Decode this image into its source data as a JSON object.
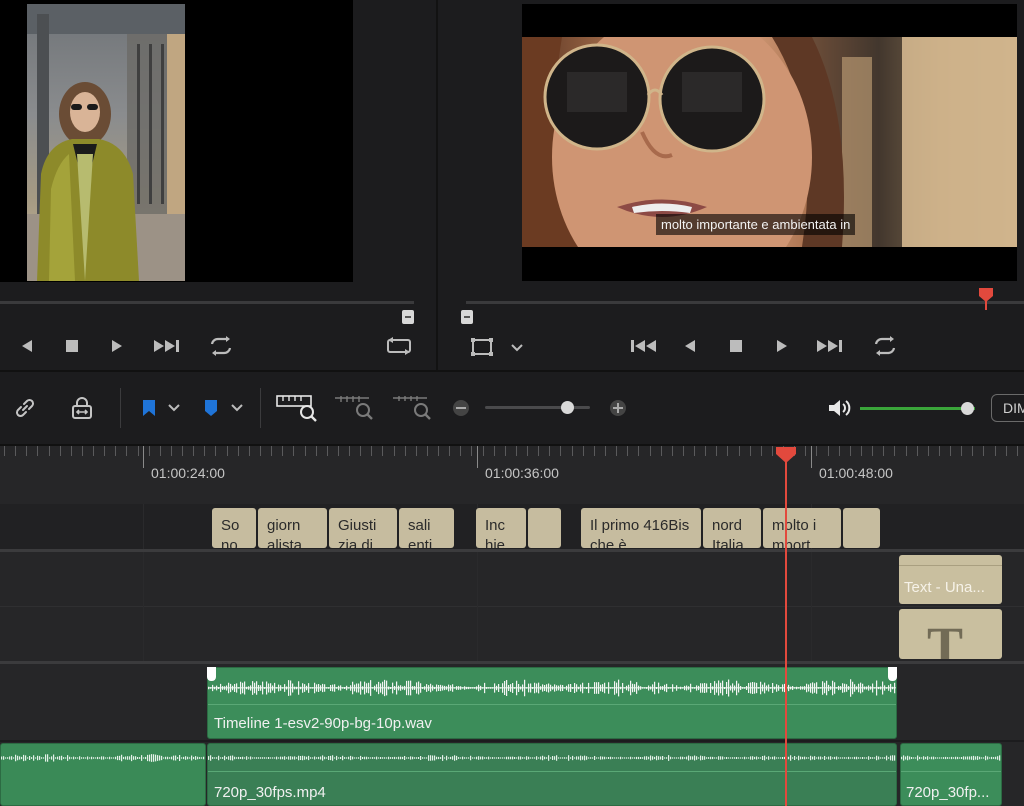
{
  "viewers": {
    "program_subtitle": "molto importante e ambientata in"
  },
  "timeline": {
    "timecodes": [
      "01:00:24:00",
      "01:00:36:00",
      "01:00:48:00"
    ],
    "subtitle_clips": [
      {
        "text": "So no"
      },
      {
        "text": "giorn alista"
      },
      {
        "text": "Giusti zia di"
      },
      {
        "text": "sali enti"
      },
      {
        "text": "Inc hie"
      },
      {
        "text": ""
      },
      {
        "text": "Il primo 416Bis che è"
      },
      {
        "text": "nord Italia"
      },
      {
        "text": "molto i mport"
      },
      {
        "text": ""
      }
    ],
    "text_clip_label": "Text - Una...",
    "audio_clip_label": "Timeline 1-esv2-90p-bg-10p.wav",
    "video_clip_label": "720p_30fps.mp4",
    "video_clip_label_right": "720p_30fp...",
    "zoom_level": 0.78,
    "volume_level": 0.93
  },
  "toolbar": {
    "dim_label": "DIM"
  },
  "colors": {
    "accent_playhead": "#e2493d",
    "audio_clip": "#3c8d5a",
    "subtitle_clip": "#c6bc9f",
    "volume_bar": "#3aa53a",
    "marker_blue": "#1f74d8"
  }
}
